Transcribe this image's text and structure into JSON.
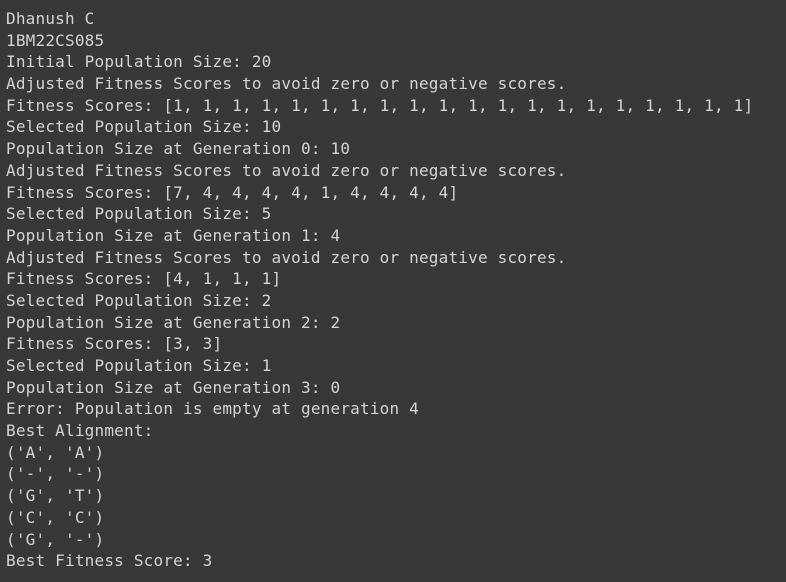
{
  "output": {
    "lines": [
      "Dhanush C",
      "1BM22CS085",
      "Initial Population Size: 20",
      "Adjusted Fitness Scores to avoid zero or negative scores.",
      "Fitness Scores: [1, 1, 1, 1, 1, 1, 1, 1, 1, 1, 1, 1, 1, 1, 1, 1, 1, 1, 1, 1]",
      "Selected Population Size: 10",
      "Population Size at Generation 0: 10",
      "Adjusted Fitness Scores to avoid zero or negative scores.",
      "Fitness Scores: [7, 4, 4, 4, 4, 1, 4, 4, 4, 4]",
      "Selected Population Size: 5",
      "Population Size at Generation 1: 4",
      "Adjusted Fitness Scores to avoid zero or negative scores.",
      "Fitness Scores: [4, 1, 1, 1]",
      "Selected Population Size: 2",
      "Population Size at Generation 2: 2",
      "Fitness Scores: [3, 3]",
      "Selected Population Size: 1",
      "Population Size at Generation 3: 0",
      "Error: Population is empty at generation 4",
      "Best Alignment:",
      "('A', 'A')",
      "('-', '-')",
      "('G', 'T')",
      "('C', 'C')",
      "('G', '-')",
      "Best Fitness Score: 3"
    ]
  },
  "colors": {
    "background": "#383838",
    "text": "#d4d4d4"
  }
}
